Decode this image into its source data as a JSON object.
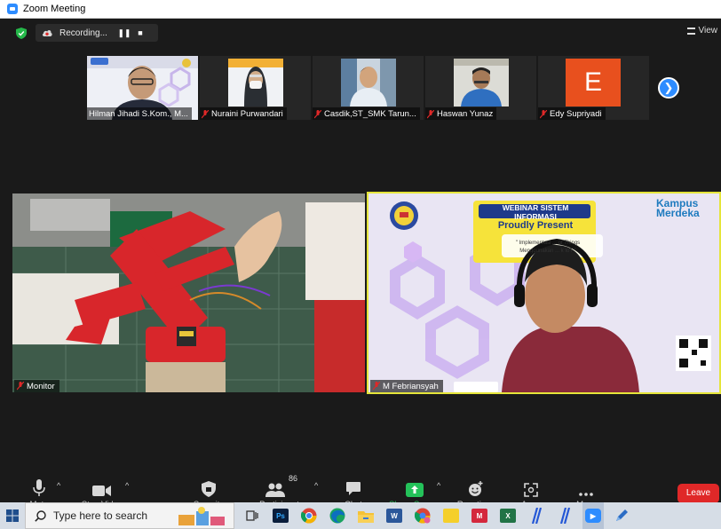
{
  "window": {
    "title": "Zoom Meeting"
  },
  "recording": {
    "label": "Recording..."
  },
  "view": {
    "label": "View"
  },
  "participants_strip": [
    {
      "name": "Hilman Jihadi S.Kom., M...",
      "muted": false
    },
    {
      "name": "Nuraini Purwandari",
      "muted": true
    },
    {
      "name": "Casdik,ST_SMK Tarun...",
      "muted": true
    },
    {
      "name": "Haswan Yunaz",
      "muted": true
    },
    {
      "name": "Edy Supriyadi",
      "muted": true,
      "avatar_letter": "E",
      "avatar_color": "#e8501e"
    }
  ],
  "main_tiles": [
    {
      "name": "Monitor",
      "muted": true
    },
    {
      "name": "M Febriansyah",
      "muted": true,
      "slide": {
        "banner_line1": "WEBINAR SISTEM INFORMASI",
        "banner_line2": "Proudly Present",
        "topic_line1": "\" Implementasi ... of Things",
        "topic_line2": "Menggunakan ... k IoT \"",
        "brand_line1": "Kampus",
        "brand_line2": "Merdeka"
      }
    }
  ],
  "toolbar": {
    "mute": "Mute",
    "stop_video": "Stop Video",
    "security": "Security",
    "participants": "Participants",
    "participants_count": "86",
    "chat": "Chat",
    "share_screen": "Share Screen",
    "reactions": "Reactions",
    "apps": "Apps",
    "more": "More",
    "leave": "Leave"
  },
  "taskbar": {
    "search_placeholder": "Type here to search",
    "apps": [
      "task-view",
      "photoshop",
      "chrome",
      "edge",
      "file-explorer",
      "word",
      "chrome-2",
      "sticky-notes",
      "app-red",
      "excel",
      "app-blue-1",
      "app-blue-2",
      "zoom",
      "app-pen"
    ]
  },
  "colors": {
    "accent": "#2d8cff",
    "share_green": "#24c25a",
    "leave_red": "#e02828",
    "active_speaker_border": "#e5e53a"
  }
}
